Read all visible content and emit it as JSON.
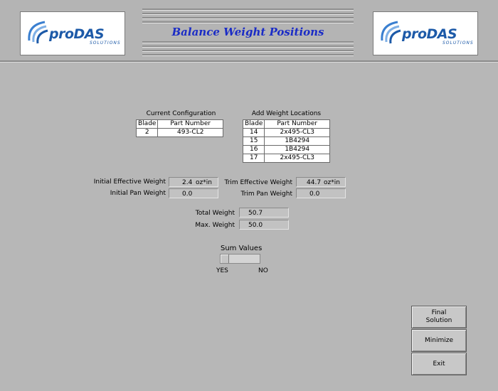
{
  "header": {
    "title": "Balance Weight Positions",
    "logo": {
      "pro": "pro",
      "das": "DAS",
      "sub": "SOLUTIONS"
    }
  },
  "current_config": {
    "title": "Current Configuration",
    "columns": [
      "Blade",
      "Part Number"
    ],
    "rows": [
      {
        "blade": "2",
        "part": "493-CL2"
      }
    ]
  },
  "add_weights": {
    "title": "Add Weight Locations",
    "columns": [
      "Blade",
      "Part Number"
    ],
    "rows": [
      {
        "blade": "14",
        "part": "2x495-CL3"
      },
      {
        "blade": "15",
        "part": "1B4294"
      },
      {
        "blade": "16",
        "part": "1B4294"
      },
      {
        "blade": "17",
        "part": "2x495-CL3"
      }
    ]
  },
  "weights": {
    "initial_effective": {
      "label": "Initial Effective Weight",
      "value": "2.4",
      "unit": "oz*in"
    },
    "initial_pan": {
      "label": "Initial Pan Weight",
      "value": "0.0"
    },
    "trim_effective": {
      "label": "Trim Effective Weight",
      "value": "44.7",
      "unit": "oz*in"
    },
    "trim_pan": {
      "label": "Trim Pan Weight",
      "value": "0.0"
    },
    "total": {
      "label": "Total Weight",
      "value": "50.7"
    },
    "max": {
      "label": "Max. Weight",
      "value": "50.0"
    }
  },
  "sum_values": {
    "label": "Sum Values",
    "yes": "YES",
    "no": "NO",
    "selected": "YES"
  },
  "buttons": {
    "final_solution": "Final Solution",
    "minimize": "Minimize",
    "exit": "Exit"
  }
}
